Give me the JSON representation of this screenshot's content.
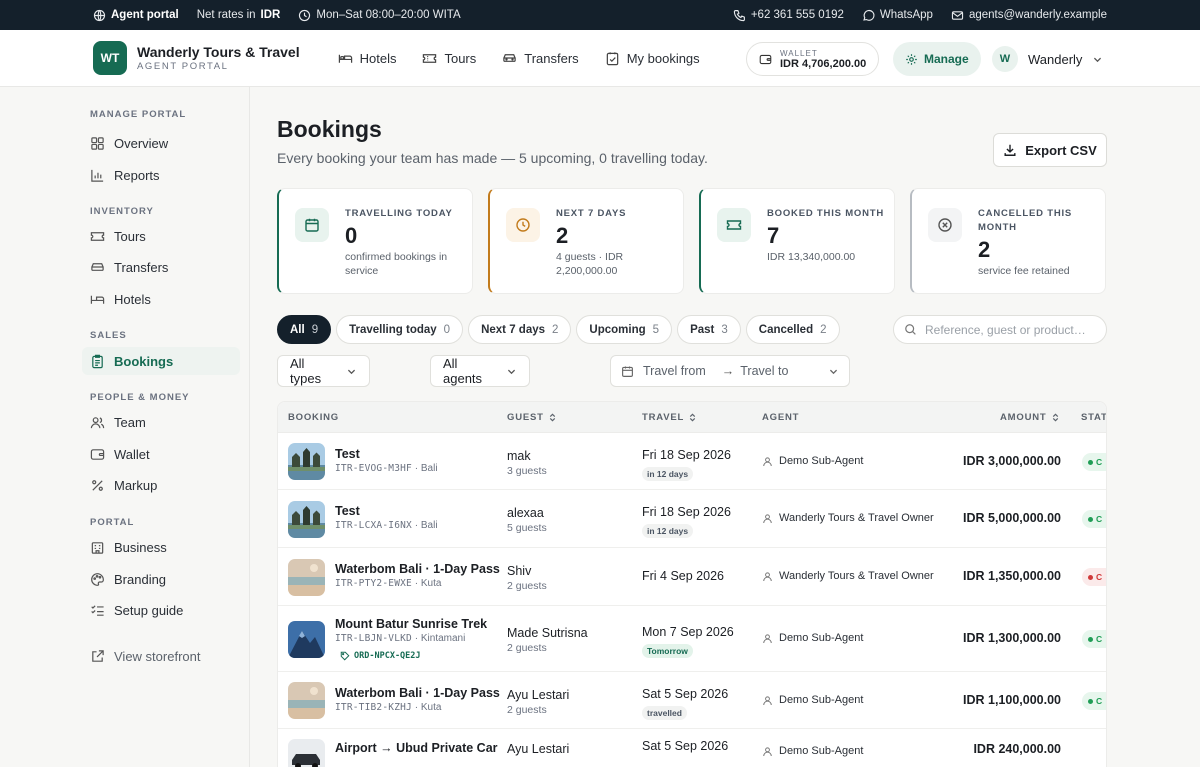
{
  "topbar": {
    "portal": "Agent portal",
    "rates_prefix": "Net rates in",
    "rates_currency": "IDR",
    "hours": "Mon–Sat 08:00–20:00 WITA",
    "phone": "+62 361 555 0192",
    "whatsapp": "WhatsApp",
    "email": "agents@wanderly.example"
  },
  "header": {
    "logo": "WT",
    "brand_name": "Wanderly Tours & Travel",
    "brand_sub": "AGENT PORTAL",
    "nav": [
      "Hotels",
      "Tours",
      "Transfers",
      "My bookings"
    ],
    "wallet_label": "WALLET",
    "wallet_value": "IDR 4,706,200.00",
    "manage": "Manage",
    "user_initial": "W",
    "user_name": "Wanderly"
  },
  "sidebar": {
    "sections": [
      "MANAGE PORTAL",
      "INVENTORY",
      "SALES",
      "PEOPLE & MONEY",
      "PORTAL"
    ],
    "items": [
      "Overview",
      "Reports",
      "Tours",
      "Transfers",
      "Hotels",
      "Bookings",
      "Team",
      "Wallet",
      "Markup",
      "Business",
      "Branding",
      "Setup guide"
    ],
    "storefront": "View storefront"
  },
  "page": {
    "title": "Bookings",
    "subtitle": "Every booking your team has made — 5 upcoming, 0 travelling today.",
    "export": "Export CSV"
  },
  "stats": [
    {
      "label": "TRAVELLING TODAY",
      "value": "0",
      "desc": "confirmed bookings in service",
      "color": "#166b53",
      "tint": "#e8f3ee"
    },
    {
      "label": "NEXT 7 DAYS",
      "value": "2",
      "desc": "4 guests · IDR 2,200,000.00",
      "color": "#c27b1c",
      "tint": "#fcf3e6"
    },
    {
      "label": "BOOKED THIS MONTH",
      "value": "7",
      "desc": "IDR 13,340,000.00",
      "color": "#166b53",
      "tint": "#e8f3ee"
    },
    {
      "label": "CANCELLED THIS MONTH",
      "value": "2",
      "desc": "service fee retained",
      "color": "#b7bcc2",
      "tint": "#f3f4f5"
    }
  ],
  "tabs": [
    {
      "label": "All",
      "count": "9"
    },
    {
      "label": "Travelling today",
      "count": "0"
    },
    {
      "label": "Next 7 days",
      "count": "2"
    },
    {
      "label": "Upcoming",
      "count": "5"
    },
    {
      "label": "Past",
      "count": "3"
    },
    {
      "label": "Cancelled",
      "count": "2"
    }
  ],
  "search": {
    "placeholder": "Reference, guest or product…"
  },
  "filters": {
    "types": "All types",
    "agents": "All agents",
    "travel_from": "Travel from",
    "arrow": "→",
    "travel_to": "Travel to"
  },
  "table": {
    "headers": [
      "BOOKING",
      "GUEST",
      "TRAVEL",
      "AGENT",
      "AMOUNT",
      "STAT"
    ],
    "rows": [
      {
        "name": "Test",
        "code": "ITR-EVOG-M3HF",
        "place": "Bali",
        "order": "",
        "guest": "mak",
        "guests": "3 guests",
        "date": "Fri 18 Sep 2026",
        "badge": "in 12 days",
        "agent": "Demo Sub-Agent",
        "amount": "IDR 3,000,000.00",
        "status": "C",
        "status_color": "#1f9d55",
        "status_bg": "#e7f6ed",
        "thumb": "temple"
      },
      {
        "name": "Test",
        "code": "ITR-LCXA-I6NX",
        "place": "Bali",
        "order": "",
        "guest": "alexaa",
        "guests": "5 guests",
        "date": "Fri 18 Sep 2026",
        "badge": "in 12 days",
        "agent": "Wanderly Tours & Travel Owner",
        "amount": "IDR 5,000,000.00",
        "status": "C",
        "status_color": "#1f9d55",
        "status_bg": "#e7f6ed",
        "thumb": "temple"
      },
      {
        "name": "Waterbom Bali · 1-Day Pass",
        "code": "ITR-PTY2-EWXE",
        "place": "Kuta",
        "order": "",
        "guest": "Shiv",
        "guests": "2 guests",
        "date": "Fri 4 Sep 2026",
        "badge": "",
        "agent": "Wanderly Tours & Travel Owner",
        "amount": "IDR 1,350,000.00",
        "status": "C",
        "status_color": "#d03a3a",
        "status_bg": "#fbeaea",
        "thumb": "beach"
      },
      {
        "name": "Mount Batur Sunrise Trek",
        "code": "ITR-LBJN-VLKD",
        "place": "Kintamani",
        "order": "ORD-NPCX-QE2J",
        "guest": "Made Sutrisna",
        "guests": "2 guests",
        "date": "Mon 7 Sep 2026",
        "badge": "Tomorrow",
        "agent": "Demo Sub-Agent",
        "amount": "IDR 1,300,000.00",
        "status": "C",
        "status_color": "#1f9d55",
        "status_bg": "#e7f6ed",
        "thumb": "mountain"
      },
      {
        "name": "Waterbom Bali · 1-Day Pass",
        "code": "ITR-TIB2-KZHJ",
        "place": "Kuta",
        "order": "",
        "guest": "Ayu Lestari",
        "guests": "2 guests",
        "date": "Sat 5 Sep 2026",
        "badge": "travelled",
        "agent": "Demo Sub-Agent",
        "amount": "IDR 1,100,000.00",
        "status": "C",
        "status_color": "#1f9d55",
        "status_bg": "#e7f6ed",
        "thumb": "beach"
      },
      {
        "name": "Airport → Ubud Private Car",
        "code": "",
        "place": "",
        "order": "",
        "guest": "Ayu Lestari",
        "guests": "",
        "date": "Sat 5 Sep 2026",
        "badge": "",
        "agent": "Demo Sub-Agent",
        "amount": "IDR 240,000.00",
        "status": "",
        "status_color": "#1f9d55",
        "status_bg": "#e7f6ed",
        "thumb": "car"
      }
    ]
  },
  "icons": {
    "globe": "globe-icon",
    "tag": "tag-icon",
    "clock": "clock-icon",
    "phone": "phone-icon",
    "whatsapp": "whatsapp-icon",
    "mail": "mail-icon",
    "bed": "bed-icon",
    "ticket": "ticket-icon",
    "car": "car-icon",
    "clipboard": "clipboard-icon",
    "wallet": "wallet-icon",
    "gear": "gear-icon",
    "chevron": "chevron-down-icon",
    "grid": "grid-icon",
    "chart": "bar-chart-icon",
    "users": "users-icon",
    "percent": "percent-icon",
    "building": "building-icon",
    "palette": "palette-icon",
    "checklist": "checklist-icon",
    "external": "external-link-icon",
    "calendar": "calendar-icon",
    "x-circle": "x-circle-icon",
    "download": "download-icon",
    "search": "search-icon",
    "sort": "sort-icon",
    "user": "user-icon"
  }
}
